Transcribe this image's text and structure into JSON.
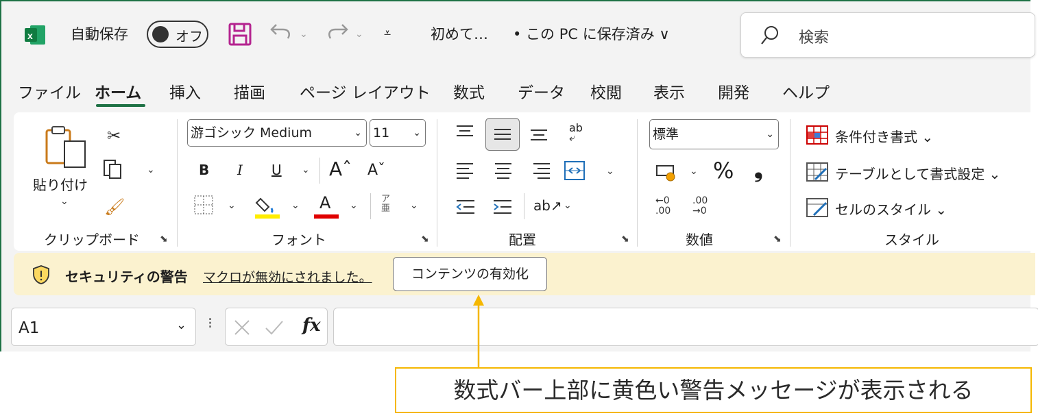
{
  "titlebar": {
    "autosave_label": "自動保存",
    "autosave_state": "オフ",
    "filename": "初めて…",
    "save_status": "• この PC に保存済み ∨",
    "search_placeholder": "検索"
  },
  "tabs": [
    "ファイル",
    "ホーム",
    "挿入",
    "描画",
    "ページ レイアウト",
    "数式",
    "データ",
    "校閲",
    "表示",
    "開発",
    "ヘルプ"
  ],
  "active_tab": "ホーム",
  "ribbon": {
    "clipboard": {
      "paste_label": "貼り付け",
      "group_label": "クリップボード"
    },
    "font": {
      "font_name": "游ゴシック Medium",
      "font_size": "11",
      "group_label": "フォント",
      "bold": "B",
      "italic": "I",
      "underline": "U",
      "font_color_glyph": "A",
      "phonetic_glyph": "ア\n亜"
    },
    "alignment": {
      "group_label": "配置"
    },
    "number": {
      "format": "標準",
      "percent": "%",
      "comma": "❟",
      "group_label": "数値",
      "inc_decimal": "←0\n.00",
      "dec_decimal": ".00\n→0"
    },
    "styles": {
      "conditional": "条件付き書式 ⌄",
      "table": "テーブルとして書式設定 ⌄",
      "cell": "セルのスタイル ⌄",
      "group_label": "スタイル"
    }
  },
  "security_bar": {
    "title": "セキュリティの警告",
    "message": "マクロが無効にされました。",
    "button": "コンテンツの有効化"
  },
  "formula_bar": {
    "name_box": "A1",
    "fx": "fx"
  },
  "annotation": {
    "text": "数式バー上部に黄色い警告メッセージが表示される"
  },
  "colors": {
    "excel_green": "#1e7145",
    "warning_bg": "#fbf2cf",
    "callout_border": "#f5b700",
    "save_icon": "#b4238f"
  }
}
